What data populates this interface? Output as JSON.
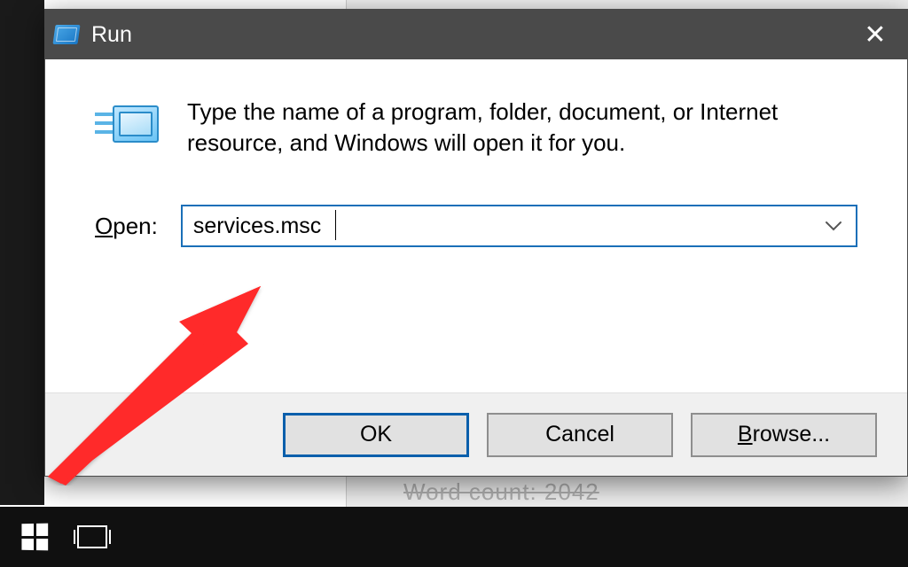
{
  "dialog": {
    "title": "Run",
    "description": "Type the name of a program, folder, document, or Internet resource, and Windows will open it for you.",
    "open_label_pre": "O",
    "open_label_rest": "pen:",
    "input_value": "services.msc",
    "buttons": {
      "ok": "OK",
      "cancel": "Cancel",
      "browse_pre": "B",
      "browse_rest": "rowse..."
    }
  },
  "background": {
    "partial_text": "Word count: 2042"
  }
}
